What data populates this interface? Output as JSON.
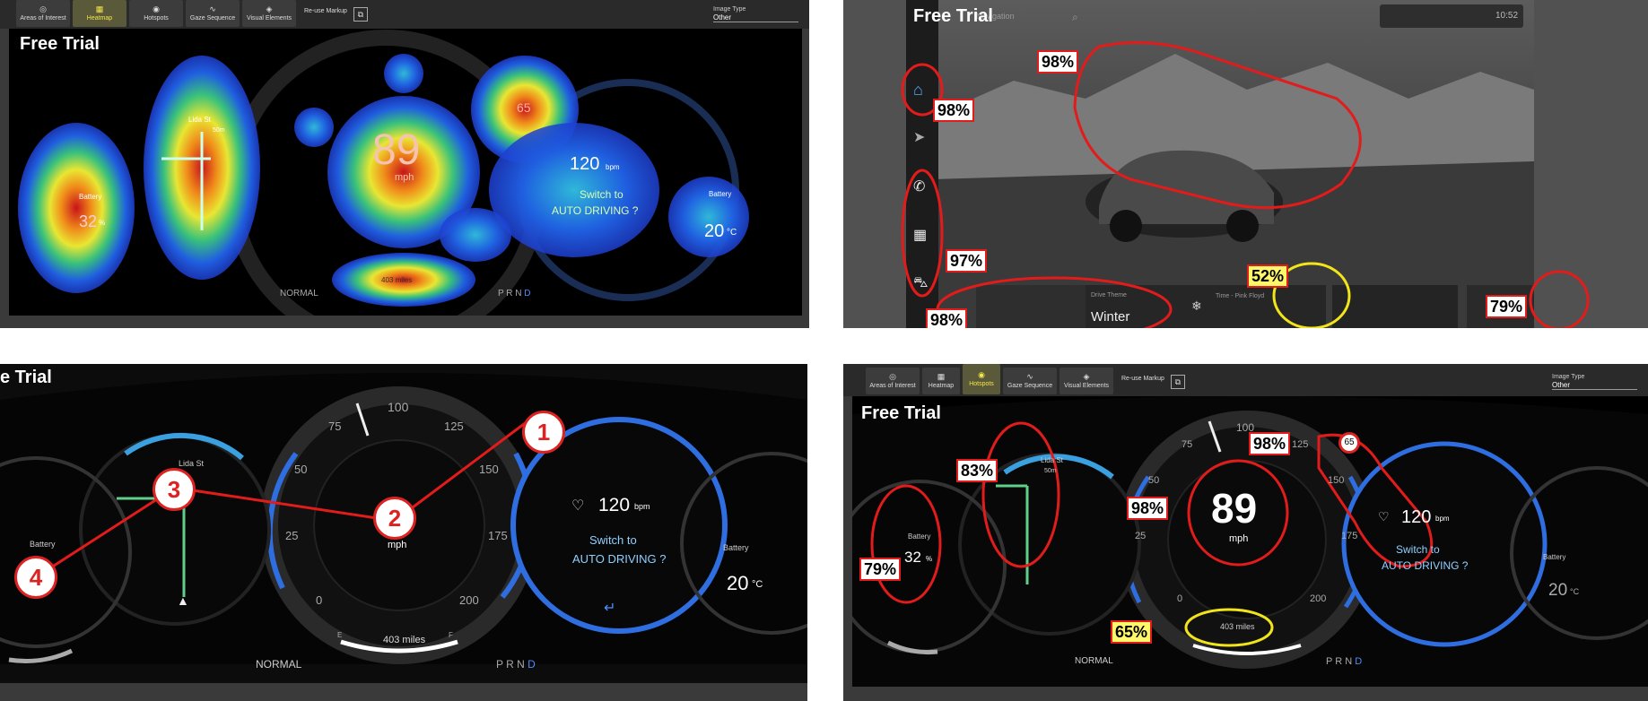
{
  "toolbar": {
    "areas_label": "Areas of Interest",
    "heatmap_label": "Heatmap",
    "hotspots_label": "Hotspots",
    "gaze_label": "Gaze Sequence",
    "visual_label": "Visual Elements",
    "reuse_label": "Re-use Markup",
    "image_type_label": "Image Type",
    "image_type_value": "Other"
  },
  "watermark": "Free Trial",
  "watermark_cut": "e Trial",
  "dashboard": {
    "speed": "89",
    "speed_unit": "mph",
    "limit": "65",
    "bpm": "120",
    "bpm_unit": "bpm",
    "auto_line1": "Switch to",
    "auto_line2": "AUTO DRIVING ?",
    "battery_label": "Battery",
    "battery_value": "32",
    "battery_unit": "%",
    "temp_value": "20",
    "temp_unit": "°C",
    "street": "Lida St",
    "street_dist": "50m",
    "range": "403 miles",
    "mode": "NORMAL",
    "gear": "P R N",
    "gear_active": "D",
    "ticks": [
      "0",
      "25",
      "50",
      "75",
      "100",
      "125",
      "150",
      "175",
      "200"
    ],
    "fuel_e": "E",
    "fuel_f": "F"
  },
  "panel1": {
    "battery_label": "Battery",
    "battery_value": "32",
    "battery_unit": "%"
  },
  "panel2": {
    "search_placeholder": "Navigation",
    "time": "10:52",
    "drive_theme_label": "Drive Theme",
    "drive_theme_value": "Winter",
    "music_label": "Time - Pink Floyd",
    "tags": [
      "98%",
      "98%",
      "97%",
      "98%",
      "52%",
      "79%"
    ]
  },
  "panel3": {
    "markers": [
      "1",
      "2",
      "3",
      "4"
    ]
  },
  "panel4": {
    "tags": [
      "83%",
      "98%",
      "98%",
      "79%",
      "65%"
    ]
  }
}
